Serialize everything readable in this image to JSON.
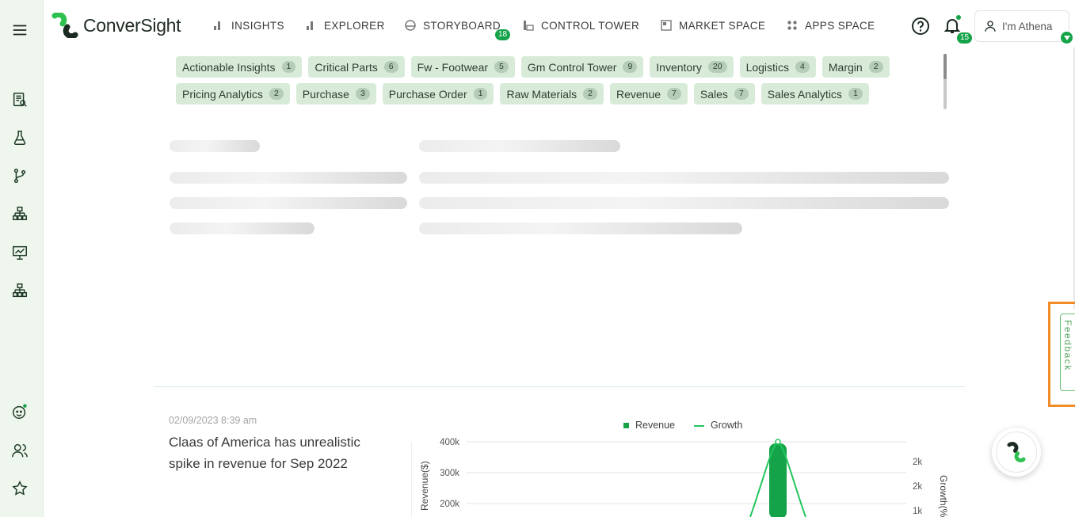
{
  "app": {
    "logo_text": "ConverSight"
  },
  "nav": {
    "items": [
      {
        "label": "INSIGHTS",
        "icon": "bar-chart-icon"
      },
      {
        "label": "EXPLORER",
        "icon": "bar-chart-icon"
      },
      {
        "label": "STORYBOARD",
        "icon": "storyboard-icon",
        "badge": "18"
      },
      {
        "label": "CONTROL TOWER",
        "icon": "control-tower-icon"
      },
      {
        "label": "MARKET SPACE",
        "icon": "market-icon"
      },
      {
        "label": "APPS SPACE",
        "icon": "apps-grid-icon"
      }
    ]
  },
  "header": {
    "notification_count": "15",
    "user_label": "I'm Athena"
  },
  "tags": {
    "row1": [
      {
        "label": "Actionable Insights",
        "count": "1"
      },
      {
        "label": "Critical Parts",
        "count": "6"
      },
      {
        "label": "Fw - Footwear",
        "count": "5"
      },
      {
        "label": "Gm Control Tower",
        "count": "9"
      },
      {
        "label": "Inventory",
        "count": "20"
      },
      {
        "label": "Logistics",
        "count": "4"
      },
      {
        "label": "Margin",
        "count": "2"
      }
    ],
    "row2": [
      {
        "label": "Pricing Analytics",
        "count": "2"
      },
      {
        "label": "Purchase",
        "count": "3"
      },
      {
        "label": "Purchase Order",
        "count": "1"
      },
      {
        "label": "Raw Materials",
        "count": "2"
      },
      {
        "label": "Revenue",
        "count": "7"
      },
      {
        "label": "Sales",
        "count": "7"
      },
      {
        "label": "Sales Analytics",
        "count": "1"
      }
    ]
  },
  "insight": {
    "date": "02/09/2023 8:39 am",
    "title": "Claas of America has unrealistic spike in revenue for Sep 2022"
  },
  "chart_data": {
    "type": "bar",
    "legend": [
      {
        "name": "Revenue",
        "color": "#15a34a",
        "kind": "bar"
      },
      {
        "name": "Growth",
        "color": "#22c55e",
        "kind": "line"
      }
    ],
    "legend_placement": "top",
    "ylabel": "Revenue($)",
    "ylabel_right": "Growth(%)",
    "y_ticks": [
      "400k",
      "300k",
      "200k"
    ],
    "y_ticks_right": [
      "2k",
      "2k",
      "1k"
    ],
    "ylim": [
      0,
      400000
    ],
    "spike_value": 400000,
    "grid": true
  },
  "feedback": {
    "label": "Feedback"
  },
  "colors": {
    "brand": "#15a34a",
    "sidebar_bg": "#eef6ee",
    "tag_bg": "#d8ebd9",
    "highlight": "#f28c28"
  }
}
